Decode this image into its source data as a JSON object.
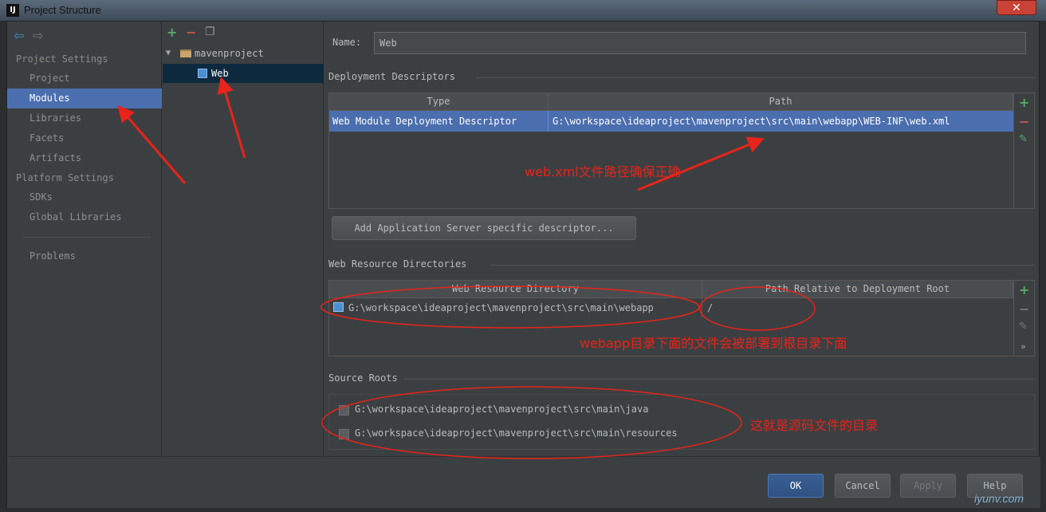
{
  "window": {
    "title": "Project Structure",
    "icon_label": "IJ",
    "close_label": "✕"
  },
  "nav": {
    "project_settings_label": "Project Settings",
    "project_settings": [
      "Project",
      "Modules",
      "Libraries",
      "Facets",
      "Artifacts"
    ],
    "platform_settings_label": "Platform Settings",
    "platform_settings": [
      "SDKs",
      "Global Libraries"
    ],
    "problems_label": "Problems",
    "selected": "Modules"
  },
  "tree": {
    "root": "mavenproject",
    "child": "Web"
  },
  "facet": {
    "name_label": "Name:",
    "name_value": "Web",
    "deployment_descriptors_title": "Deployment Descriptors",
    "descriptor_columns": [
      "Type",
      "Path"
    ],
    "descriptor_rows": [
      {
        "type": "Web Module Deployment Descriptor",
        "path": "G:\\workspace\\ideaproject\\mavenproject\\src\\main\\webapp\\WEB-INF\\web.xml"
      }
    ],
    "add_server_descriptor_label": "Add Application Server specific descriptor...",
    "web_resource_title": "Web Resource Directories",
    "resource_columns": [
      "Web Resource Directory",
      "Path Relative to Deployment Root"
    ],
    "resource_rows": [
      {
        "directory": "G:\\workspace\\ideaproject\\mavenproject\\src\\main\\webapp",
        "relative": "/"
      }
    ],
    "source_roots_title": "Source Roots",
    "source_roots": [
      "G:\\workspace\\ideaproject\\mavenproject\\src\\main\\java",
      "G:\\workspace\\ideaproject\\mavenproject\\src\\main\\resources"
    ]
  },
  "buttons": {
    "ok": "OK",
    "cancel": "Cancel",
    "apply": "Apply",
    "help": "Help"
  },
  "annotations": {
    "webxml_note": "web.xml文件路径确保正确",
    "webapp_note": "webapp目录下面的文件会被部署到根目录下面",
    "source_note": "这就是源码文件的目录"
  },
  "watermark": "iyunv.com",
  "colors": {
    "selection": "#4b6eaf",
    "annotation": "#e8231a",
    "add_green": "#59a869",
    "remove_red": "#c75450"
  }
}
